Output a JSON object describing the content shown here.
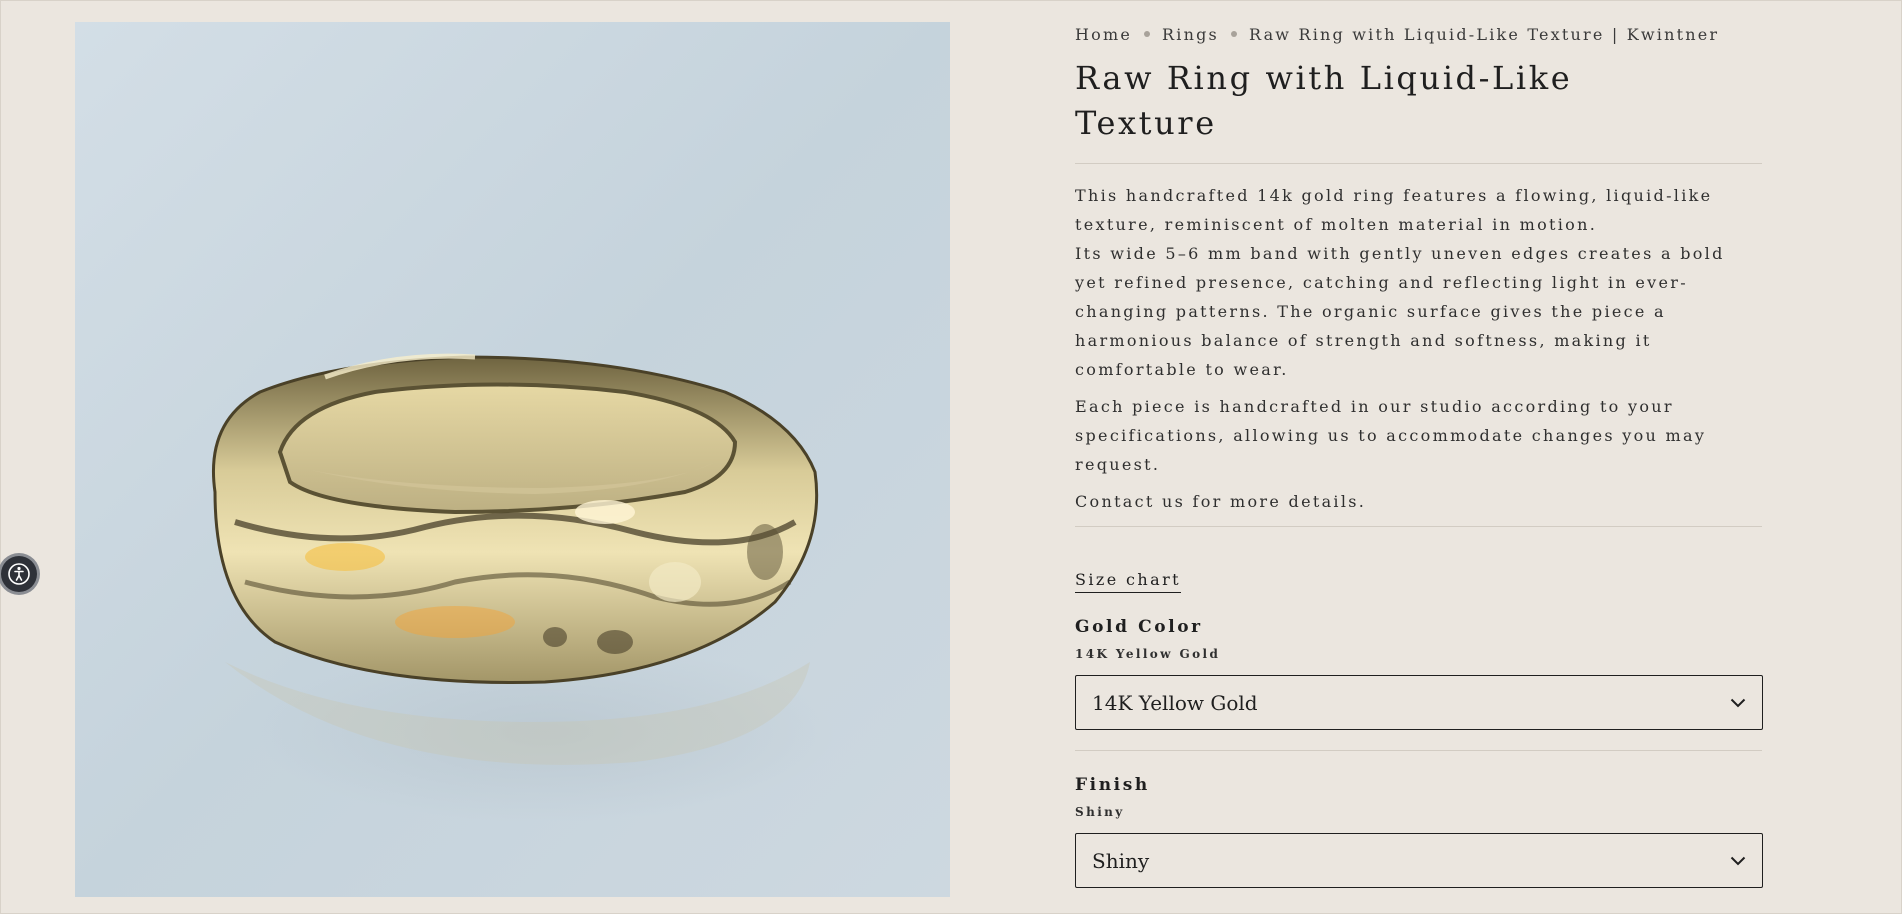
{
  "breadcrumb": {
    "items": [
      "Home",
      "Rings",
      "Raw Ring with Liquid-Like Texture | Kwintner"
    ]
  },
  "product": {
    "title": "Raw Ring with Liquid-Like Texture",
    "image_alt": "gold-ring-photo",
    "description": [
      "This handcrafted 14k gold ring features a flowing, liquid-like texture, reminiscent of molten material in motion.",
      "Its wide 5–6 mm band with gently uneven edges creates a bold yet refined presence, catching and reflecting light in ever-changing patterns. The organic surface gives the piece a harmonious balance of strength and softness, making it comfortable to wear.",
      "Each piece is handcrafted in our studio according to your specifications, allowing us to accommodate changes you may request.",
      "Contact us for more details."
    ]
  },
  "size_chart": {
    "label": "Size chart"
  },
  "options": {
    "gold_color": {
      "label": "Gold Color",
      "current": "14K Yellow Gold",
      "selected": "14K Yellow Gold"
    },
    "finish": {
      "label": "Finish",
      "current": "Shiny",
      "selected": "Shiny"
    }
  },
  "icons": {
    "accessibility": "accessibility-icon",
    "chevron": "chevron-down-icon"
  },
  "colors": {
    "background": "#ebe6df",
    "text": "#1f1f1f",
    "divider": "#d2ccc3"
  }
}
